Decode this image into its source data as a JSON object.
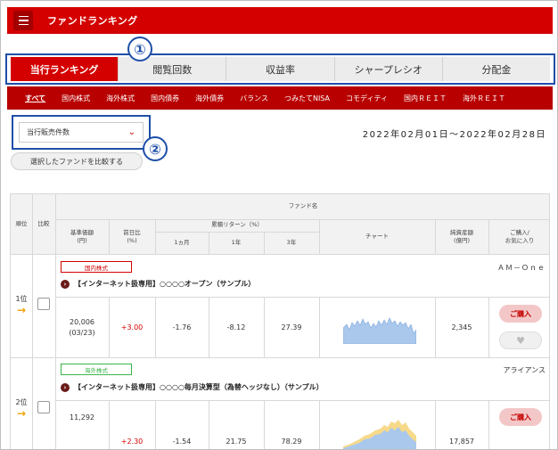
{
  "header": {
    "title": "ファンドランキング",
    "menu_icon": "hamburger-icon"
  },
  "tabs": [
    {
      "label": "当行ランキング",
      "active": true
    },
    {
      "label": "閲覧回数",
      "active": false
    },
    {
      "label": "収益率",
      "active": false
    },
    {
      "label": "シャープレシオ",
      "active": false
    },
    {
      "label": "分配金",
      "active": false
    }
  ],
  "callouts": {
    "one": "①",
    "two": "②"
  },
  "categories": [
    {
      "label": "すべて",
      "active": true
    },
    {
      "label": "国内株式"
    },
    {
      "label": "海外株式"
    },
    {
      "label": "国内債券"
    },
    {
      "label": "海外債券"
    },
    {
      "label": "バランス"
    },
    {
      "label": "つみたてNISA"
    },
    {
      "label": "コモディティ"
    },
    {
      "label": "国内ＲＥＩＴ"
    },
    {
      "label": "海外ＲＥＩＴ"
    }
  ],
  "sort_select": {
    "value": "当行販売件数"
  },
  "compare_button": "選択したファンドを比較する",
  "date_range": "2022年02月01日～2022年02月28日",
  "table": {
    "headers": {
      "rank": "順位",
      "compare": "比較",
      "fund_name": "ファンド名",
      "base_price": "基準価額\n(円)",
      "prev_change": "前日比\n(%)",
      "returns_group": "累積リターン（%）",
      "ret_1m": "1ヵ月",
      "ret_1y": "1年",
      "ret_3y": "3年",
      "chart": "チャート",
      "net_assets": "純資産額\n(億円)",
      "buy_fav": "ご購入/\nお気に入り"
    },
    "rows": [
      {
        "rank": "1位",
        "category": "国内株式",
        "category_color": "#d40000",
        "manager": "ＡＭ－Ｏｎｅ",
        "name": "【インターネット扱専用】○○○○オープン（サンプル）",
        "base_price": "20,006",
        "price_date": "(03/23)",
        "prev_change": "+3.00",
        "ret_1m": "-1.76",
        "ret_1y": "-8.12",
        "ret_3y": "27.39",
        "net_assets": "2,345",
        "buy_label": "ご購入"
      },
      {
        "rank": "2位",
        "category": "海外株式",
        "category_color": "#3bb54a",
        "manager": "アライアンス",
        "name": "【インターネット扱専用】○○○○毎月決算型（為替ヘッジなし）（サンプル）",
        "base_price": "11,292",
        "prev_change": "+2.30",
        "ret_1m": "-1.54",
        "ret_1y": "21.75",
        "ret_3y": "78.29",
        "net_assets": "17,857",
        "buy_label": "ご購入"
      }
    ]
  }
}
